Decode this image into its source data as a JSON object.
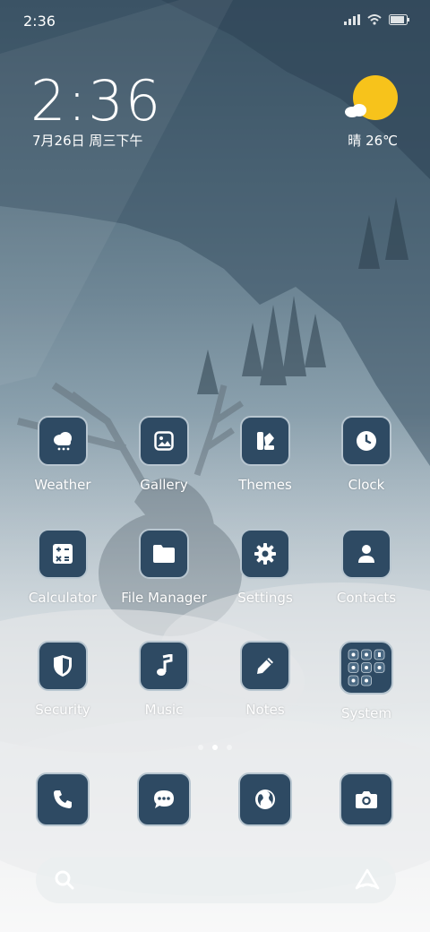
{
  "status_bar": {
    "time": "2:36"
  },
  "lock_widget": {
    "time": "2:36",
    "date": "7月26日 周三下午"
  },
  "weather_widget": {
    "text": "晴 26℃",
    "icon": "sun-cloud-icon",
    "sun_color": "#f7c31b"
  },
  "apps": [
    {
      "label": "Weather",
      "icon": "cloud-rain-icon"
    },
    {
      "label": "Gallery",
      "icon": "image-icon"
    },
    {
      "label": "Themes",
      "icon": "brush-palette-icon"
    },
    {
      "label": "Clock",
      "icon": "clock-icon"
    },
    {
      "label": "Calculator",
      "icon": "calculator-icon"
    },
    {
      "label": "File Manager",
      "icon": "folder-icon"
    },
    {
      "label": "Settings",
      "icon": "gear-icon"
    },
    {
      "label": "Contacts",
      "icon": "person-icon"
    },
    {
      "label": "Security",
      "icon": "shield-icon"
    },
    {
      "label": "Music",
      "icon": "music-note-icon"
    },
    {
      "label": "Notes",
      "icon": "pencil-icon"
    },
    {
      "label": "System",
      "icon": "folder-grid-icon"
    }
  ],
  "page_indicator": {
    "pages": 3,
    "active": 2
  },
  "dock": [
    {
      "name": "phone",
      "icon": "phone-icon"
    },
    {
      "name": "messages",
      "icon": "chat-bubble-icon"
    },
    {
      "name": "browser",
      "icon": "globe-icon"
    },
    {
      "name": "camera",
      "icon": "camera-icon"
    }
  ],
  "search": {
    "icon": "search-icon",
    "assistant_icon": "assistant-logo-icon"
  },
  "colors": {
    "tile_bg": "#2e4a63",
    "tile_border": "#b8c6d0",
    "accent_sun": "#f7c31b"
  }
}
